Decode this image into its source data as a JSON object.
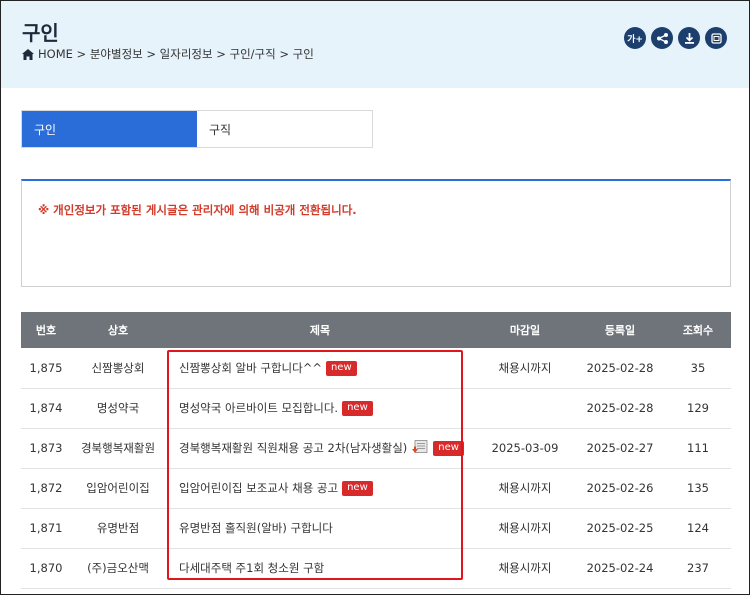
{
  "header": {
    "title": "구인",
    "breadcrumb": "HOME > 분야별정보 > 일자리정보 > 구인/구직 > 구인",
    "tools": [
      {
        "label": "가+",
        "icon": "font-size-icon"
      },
      {
        "label": "",
        "icon": "share-icon"
      },
      {
        "label": "",
        "icon": "download-icon"
      },
      {
        "label": "",
        "icon": "print-icon"
      }
    ]
  },
  "tabs": [
    {
      "label": "구인",
      "active": true
    },
    {
      "label": "구직",
      "active": false
    }
  ],
  "notice": {
    "text": "※ 개인정보가 포함된 게시글은 관리자에 의해 비공개 전환됩니다."
  },
  "table": {
    "columns": [
      "번호",
      "상호",
      "제목",
      "마감일",
      "등록일",
      "조회수"
    ],
    "rows": [
      {
        "no": "1,875",
        "company": "신짬뽕상회",
        "title": "신짬뽕상회 알바 구합니다^^",
        "deadline": "채용시까지",
        "date": "2025-02-28",
        "views": "35",
        "new": "new",
        "file": false
      },
      {
        "no": "1,874",
        "company": "명성약국",
        "title": "명성약국 아르바이트 모집합니다.",
        "deadline": "",
        "date": "2025-02-28",
        "views": "129",
        "new": "new",
        "file": false
      },
      {
        "no": "1,873",
        "company": "경북행복재활원",
        "title": "경북행복재활원 직원채용 공고 2차(남자생활실)",
        "deadline": "2025-03-09",
        "date": "2025-02-27",
        "views": "111",
        "new": "new",
        "file": true
      },
      {
        "no": "1,872",
        "company": "입암어린이집",
        "title": "입암어린이집 보조교사 채용 공고",
        "deadline": "채용시까지",
        "date": "2025-02-26",
        "views": "135",
        "new": "new",
        "file": false
      },
      {
        "no": "1,871",
        "company": "유명반점",
        "title": "유명반점 홀직원(알바) 구합니다",
        "deadline": "채용시까지",
        "date": "2025-02-25",
        "views": "124",
        "new": "",
        "file": false
      },
      {
        "no": "1,870",
        "company": "(주)금오산맥",
        "title": "다세대주택 주1회 청소원 구함",
        "deadline": "채용시까지",
        "date": "2025-02-24",
        "views": "237",
        "new": "",
        "file": false
      }
    ]
  },
  "colors": {
    "accent": "#2a6dd9",
    "header_bg": "#e6f3fb",
    "table_head": "#6e7479",
    "new_badge": "#d82a2a",
    "notice_text": "#d23b2a",
    "highlight": "#e0161c"
  }
}
